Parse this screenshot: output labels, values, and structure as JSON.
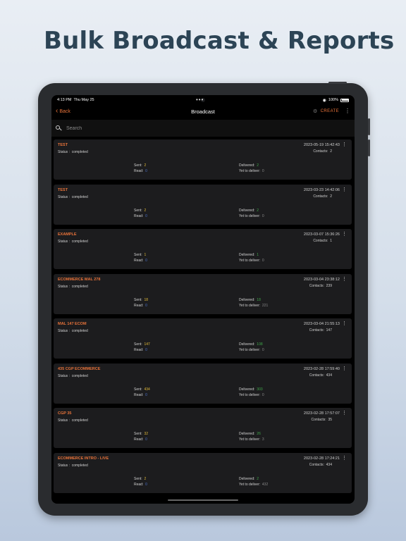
{
  "headline": "Bulk Broadcast & Reports",
  "status_bar": {
    "time": "4:13 PM",
    "date": "Thu May 25",
    "dots": "•••",
    "battery": "100%"
  },
  "nav": {
    "back_label": "Back",
    "title": "Broadcast",
    "create_label": "CREATE"
  },
  "search": {
    "placeholder": "Search"
  },
  "labels": {
    "status": "Status :",
    "contacts": "Contacts:",
    "sent": "Sent:",
    "read": "Read:",
    "delivered": "Delivered:",
    "yet": "Yet to deliver:"
  },
  "broadcasts": [
    {
      "name": "TEST",
      "status": "completed",
      "date": "2023-05-19 15:42:43",
      "contacts": "2",
      "sent": "2",
      "read": "0",
      "delivered": "2",
      "yet": "0"
    },
    {
      "name": "TEST",
      "status": "completed",
      "date": "2023-03-23 14:42:06",
      "contacts": "2",
      "sent": "2",
      "read": "0",
      "delivered": "2",
      "yet": "0"
    },
    {
      "name": "EXAMPLE",
      "status": "completed",
      "date": "2023-03-07 15:36:26",
      "contacts": "1",
      "sent": "1",
      "read": "0",
      "delivered": "1",
      "yet": "0"
    },
    {
      "name": "ECOMMERCE MAL 278",
      "status": "completed",
      "date": "2023-03-04 23:38:12",
      "contacts": "239",
      "sent": "18",
      "read": "0",
      "delivered": "18",
      "yet": "221"
    },
    {
      "name": "MAL 147 ECOM",
      "status": "completed",
      "date": "2023-03-04 21:55:13",
      "contacts": "147",
      "sent": "147",
      "read": "0",
      "delivered": "108",
      "yet": "0"
    },
    {
      "name": "435 CGP ECOMMERCE",
      "status": "completed",
      "date": "2023-02-28 17:59:40",
      "contacts": "434",
      "sent": "434",
      "read": "0",
      "delivered": "303",
      "yet": "0"
    },
    {
      "name": "CGP 35",
      "status": "completed",
      "date": "2023-02-28 17:57:07",
      "contacts": "35",
      "sent": "32",
      "read": "0",
      "delivered": "26",
      "yet": "3"
    },
    {
      "name": "ECOMMERCE INTRO - LIVE",
      "status": "completed",
      "date": "2023-02-28 17:24:21",
      "contacts": "434",
      "sent": "2",
      "read": "0",
      "delivered": "2",
      "yet": "432"
    }
  ]
}
